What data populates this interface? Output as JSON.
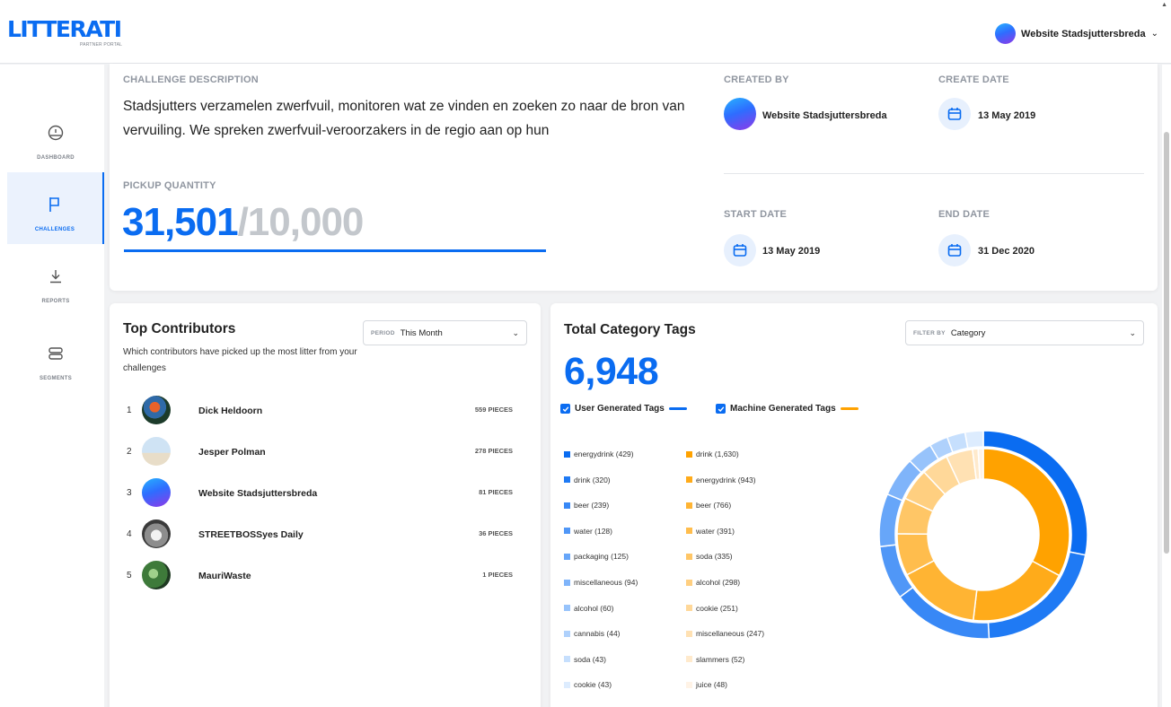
{
  "header": {
    "logo": "LITTERATI",
    "logo_sub": "PARTNER PORTAL",
    "user_name": "Website Stadsjuttersbreda"
  },
  "sidebar": {
    "items": [
      {
        "label": "DASHBOARD",
        "icon": "dashboard-gauge-icon"
      },
      {
        "label": "CHALLENGES",
        "icon": "flag-icon",
        "active": true
      },
      {
        "label": "REPORTS",
        "icon": "download-icon"
      },
      {
        "label": "SEGMENTS",
        "icon": "segments-icon"
      }
    ]
  },
  "challenge": {
    "description_label": "CHALLENGE DESCRIPTION",
    "description": "Stadsjutters verzamelen zwerfvuil, monitoren wat ze vinden en zoeken zo naar de bron van vervuiling. We spreken zwerfvuil-veroorzakers in de regio aan op hun",
    "pickup_label": "PICKUP QUANTITY",
    "pickup_current": "31,501",
    "pickup_target": "/10,000",
    "progress_fraction": 1.0,
    "created_by_label": "CREATED BY",
    "created_by": "Website Stadsjuttersbreda",
    "create_date_label": "CREATE DATE",
    "create_date": "13 May 2019",
    "start_date_label": "START DATE",
    "start_date": "13 May 2019",
    "end_date_label": "END DATE",
    "end_date": "31 Dec 2020"
  },
  "contributors": {
    "title": "Top Contributors",
    "subtitle": "Which contributors have picked up the most litter from your challenges",
    "period_prefix": "PERIOD",
    "period_value": "This Month",
    "rows": [
      {
        "rank": "1",
        "name": "Dick Heldoorn",
        "pieces": "559 PIECES"
      },
      {
        "rank": "2",
        "name": "Jesper Polman",
        "pieces": "278 PIECES"
      },
      {
        "rank": "3",
        "name": "Website Stadsjuttersbreda",
        "pieces": "81 PIECES"
      },
      {
        "rank": "4",
        "name": "STREETBOSSyes Daily",
        "pieces": "36 PIECES"
      },
      {
        "rank": "5",
        "name": "MauriWaste",
        "pieces": "1 PIECES"
      }
    ]
  },
  "tags": {
    "title": "Total Category Tags",
    "filter_prefix": "FILTER BY",
    "filter_value": "Category",
    "total": "6,948",
    "user_toggle_label": "User Generated Tags",
    "machine_toggle_label": "Machine Generated Tags",
    "colors": {
      "user": "#0a6cf1",
      "machine": "#ffa200"
    },
    "user_tags": [
      {
        "label": "energydrink (429)",
        "value": 429,
        "color": "#0a6cf1"
      },
      {
        "label": "drink (320)",
        "value": 320,
        "color": "#1f7af4"
      },
      {
        "label": "beer (239)",
        "value": 239,
        "color": "#3888f6"
      },
      {
        "label": "water (128)",
        "value": 128,
        "color": "#5097f7"
      },
      {
        "label": "packaging (125)",
        "value": 125,
        "color": "#67a6f9"
      },
      {
        "label": "miscellaneous (94)",
        "value": 94,
        "color": "#7fb4fa"
      },
      {
        "label": "alcohol (60)",
        "value": 60,
        "color": "#97c3fb"
      },
      {
        "label": "cannabis (44)",
        "value": 44,
        "color": "#afd1fc"
      },
      {
        "label": "soda (43)",
        "value": 43,
        "color": "#c6dffd"
      },
      {
        "label": "cookie (43)",
        "value": 43,
        "color": "#ddecfe"
      }
    ],
    "machine_tags": [
      {
        "label": "drink (1,630)",
        "value": 1630,
        "color": "#ffa200"
      },
      {
        "label": "energydrink (943)",
        "value": 943,
        "color": "#ffab1a"
      },
      {
        "label": "beer (766)",
        "value": 766,
        "color": "#ffb433"
      },
      {
        "label": "water (391)",
        "value": 391,
        "color": "#ffbd4d"
      },
      {
        "label": "soda (335)",
        "value": 335,
        "color": "#ffc666"
      },
      {
        "label": "alcohol (298)",
        "value": 298,
        "color": "#ffcf80"
      },
      {
        "label": "cookie (251)",
        "value": 251,
        "color": "#ffd899"
      },
      {
        "label": "miscellaneous (247)",
        "value": 247,
        "color": "#ffe1b3"
      },
      {
        "label": "slammers (52)",
        "value": 52,
        "color": "#ffeacc"
      },
      {
        "label": "juice (48)",
        "value": 48,
        "color": "#fff3e6"
      }
    ]
  }
}
